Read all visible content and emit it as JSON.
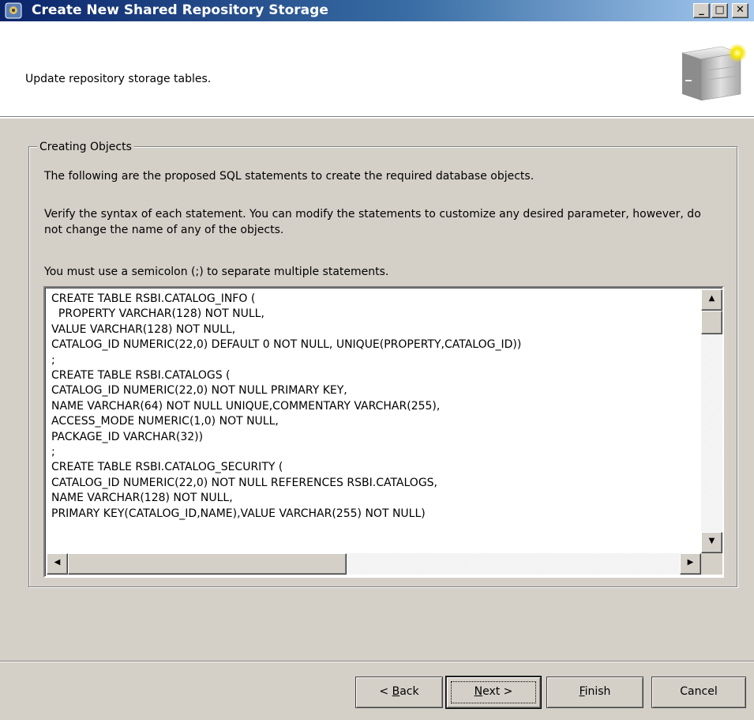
{
  "window": {
    "title": "Create New Shared Repository Storage",
    "controls": {
      "minimize": "_",
      "maximize": "□",
      "close": "✕"
    }
  },
  "banner": {
    "description": "Update repository storage tables.",
    "icon": "database-server-icon"
  },
  "group": {
    "legend": "Creating Objects",
    "paragraph1": "The following are the proposed SQL statements to create the required database objects.",
    "paragraph2": "Verify the syntax of each statement. You can modify the statements to customize any desired parameter, however, do not change the name of any of the objects.",
    "paragraph3": "You must use a semicolon (;) to separate multiple statements.",
    "sql_text": "CREATE TABLE RSBI.CATALOG_INFO (\n  PROPERTY VARCHAR(128) NOT NULL,\nVALUE VARCHAR(128) NOT NULL,\nCATALOG_ID NUMERIC(22,0) DEFAULT 0 NOT NULL, UNIQUE(PROPERTY,CATALOG_ID))\n;\nCREATE TABLE RSBI.CATALOGS (\nCATALOG_ID NUMERIC(22,0) NOT NULL PRIMARY KEY,\nNAME VARCHAR(64) NOT NULL UNIQUE,COMMENTARY VARCHAR(255),\nACCESS_MODE NUMERIC(1,0) NOT NULL,\nPACKAGE_ID VARCHAR(32))\n;\nCREATE TABLE RSBI.CATALOG_SECURITY (\nCATALOG_ID NUMERIC(22,0) NOT NULL REFERENCES RSBI.CATALOGS,\nNAME VARCHAR(128) NOT NULL,\nPRIMARY KEY(CATALOG_ID,NAME),VALUE VARCHAR(255) NOT NULL)",
    "scroll_arrows": {
      "up": "▲",
      "down": "▼",
      "left": "◀",
      "right": "▶"
    }
  },
  "buttons": {
    "back_prefix": "< ",
    "back_key": "B",
    "back_rest": "ack",
    "next_key": "N",
    "next_rest": "ext >",
    "finish_key": "F",
    "finish_rest": "inish",
    "cancel": "Cancel"
  }
}
